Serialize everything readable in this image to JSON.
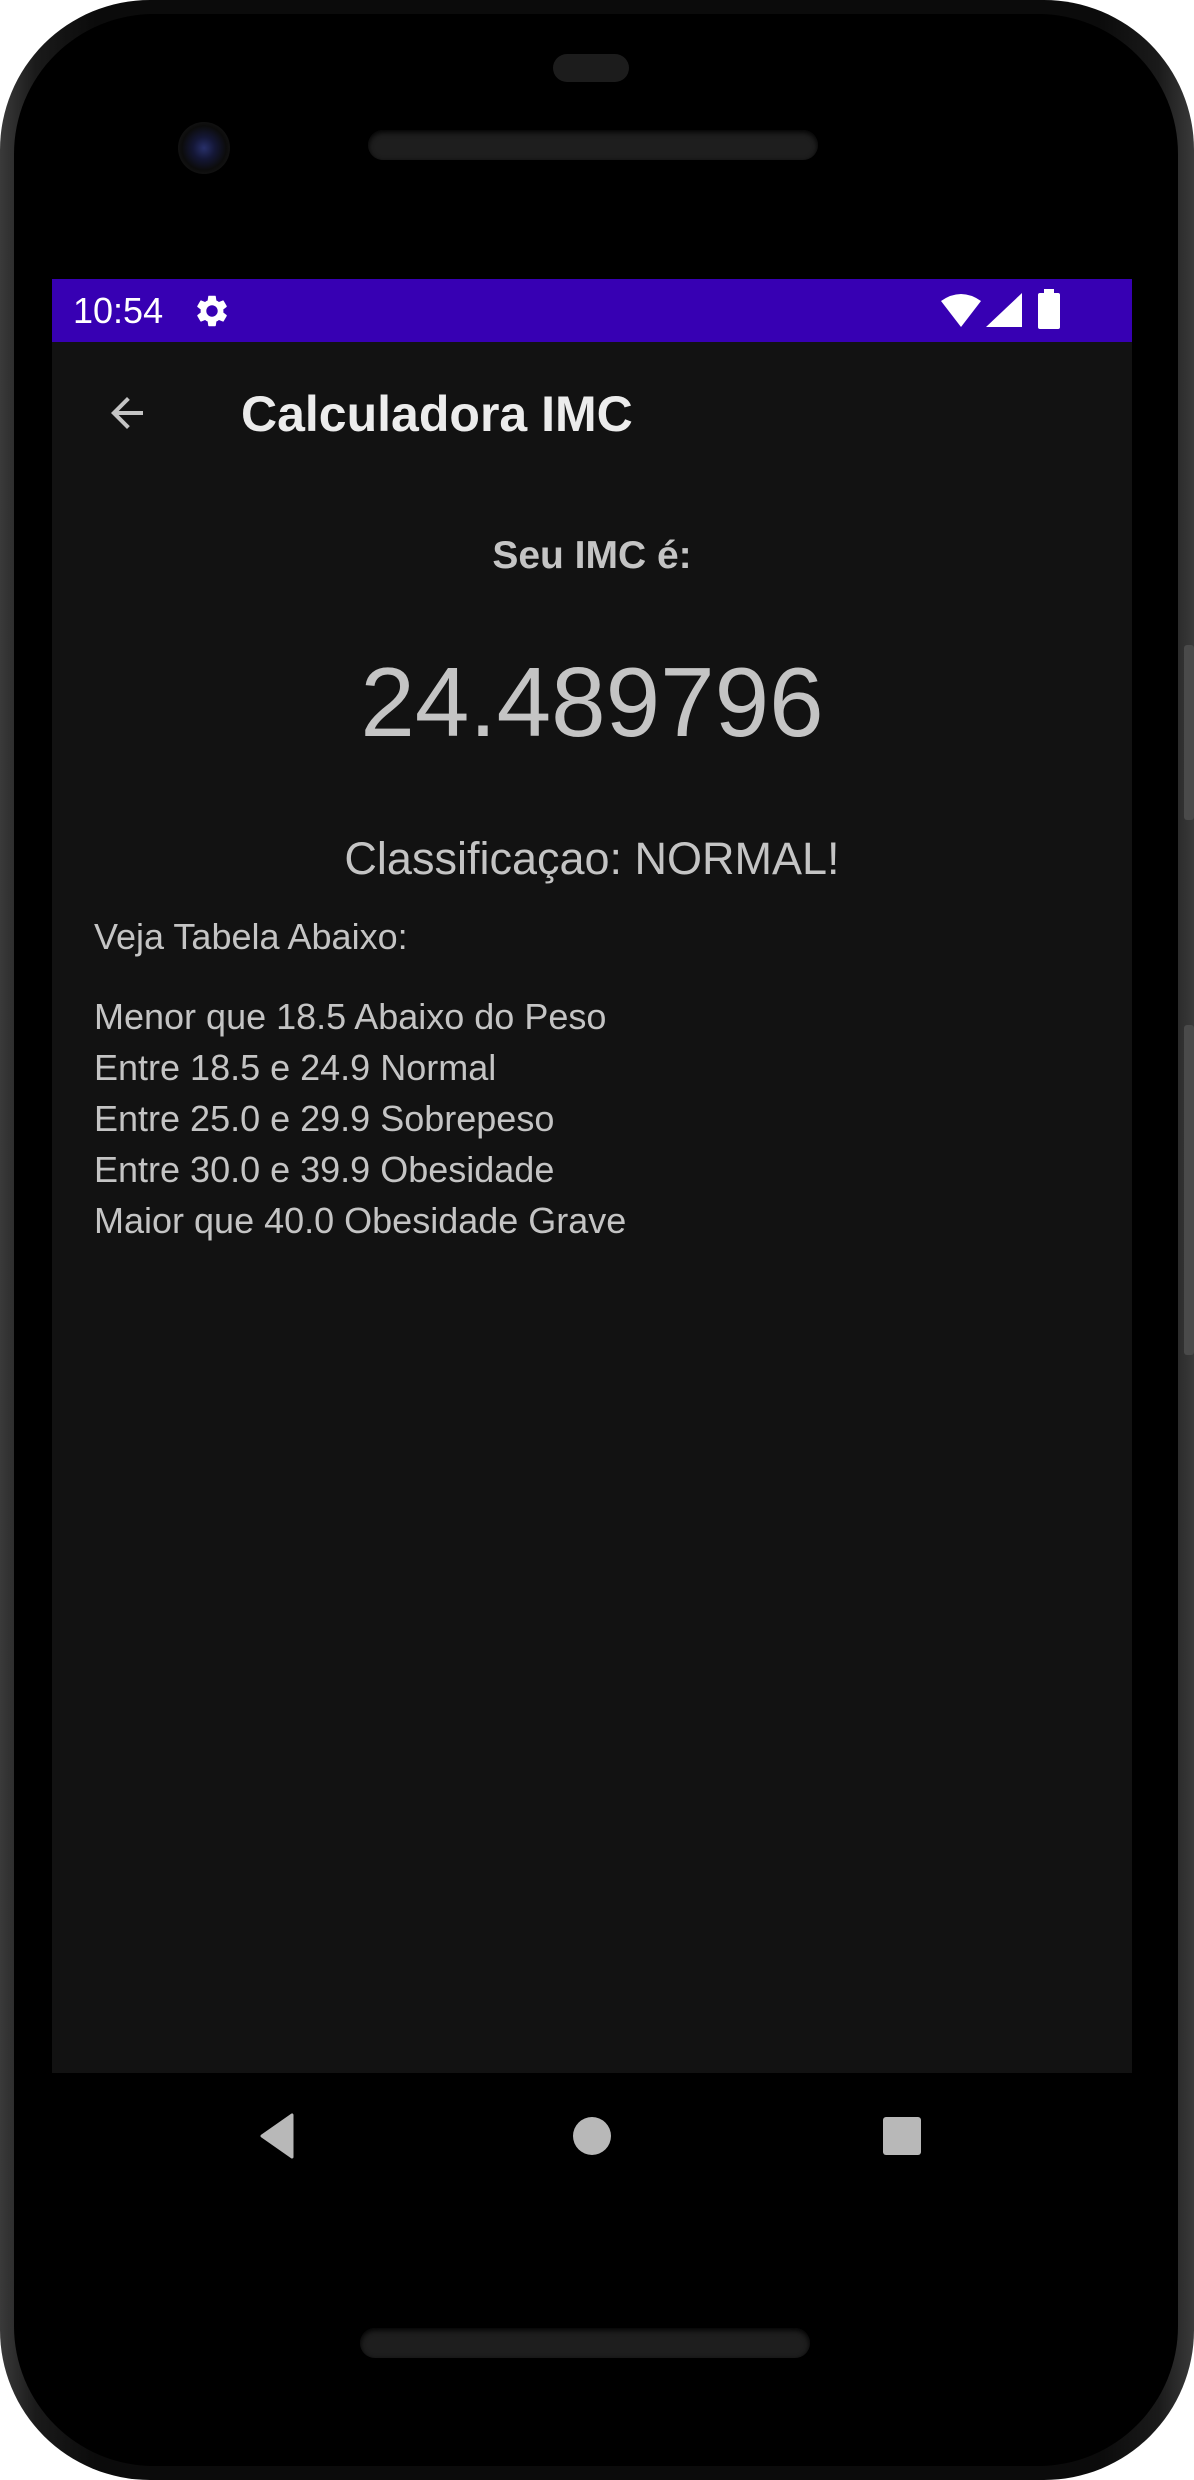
{
  "status_bar": {
    "time": "10:54",
    "background_color": "#3700b3",
    "icons": [
      "gear-icon",
      "wifi-icon",
      "signal-icon",
      "battery-icon"
    ]
  },
  "app_bar": {
    "title": "Calculadora IMC",
    "back_icon": "arrow-back-icon"
  },
  "result": {
    "label": "Seu IMC é:",
    "value": "24.489796",
    "classification": "Classificaçao: NORMAL!"
  },
  "table": {
    "intro": "Veja Tabela Abaixo:",
    "lines": [
      "Menor que 18.5 Abaixo do Peso",
      "Entre 18.5 e 24.9 Normal",
      "Entre 25.0 e 29.9 Sobrepeso",
      "Entre 30.0 e 39.9 Obesidade",
      "Maior que 40.0 Obesidade Grave"
    ]
  },
  "nav_bar": {
    "buttons": [
      "nav-back-icon",
      "nav-home-icon",
      "nav-recents-icon"
    ]
  },
  "colors": {
    "screen_background": "#121212",
    "text": "#c4c4c4",
    "title_text": "#ececec",
    "status_bar": "#3700b3"
  }
}
